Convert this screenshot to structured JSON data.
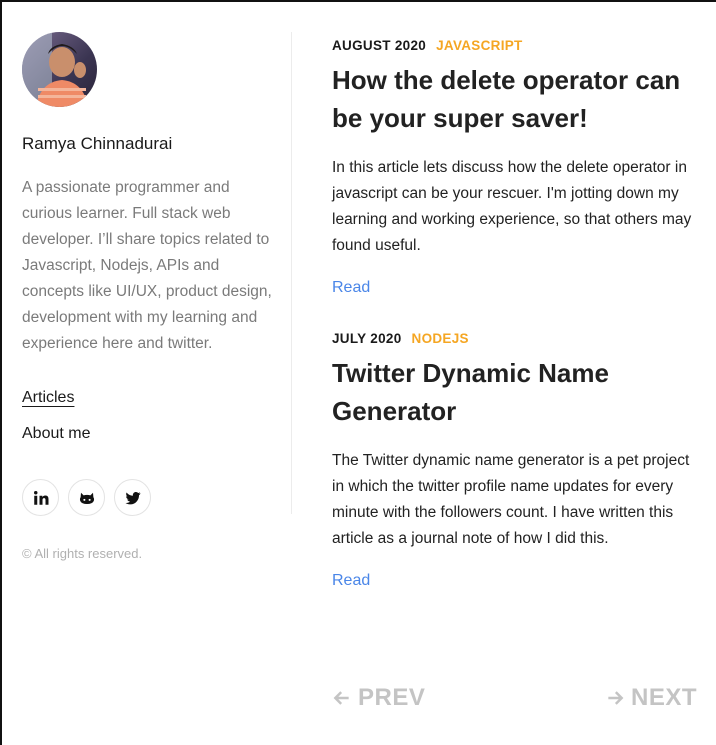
{
  "author": {
    "name": "Ramya Chinnadurai",
    "bio": "A passionate programmer and curious learner. Full stack web developer. I’ll share topics related to Javascript, Nodejs, APIs and concepts like UI/UX, product design, development with my learning and experience here and twitter."
  },
  "nav": {
    "articles": "Articles",
    "about": "About me"
  },
  "social_icons": [
    "linkedin-icon",
    "github-icon",
    "twitter-icon"
  ],
  "footer": {
    "copyright": "© All rights reserved."
  },
  "articles": [
    {
      "date": "AUGUST 2020",
      "tag": "JAVASCRIPT",
      "title": "How the delete operator can be your super saver!",
      "excerpt": "In this article lets discuss how the delete operator in javascript can be your rescuer. I'm jotting down my learning and working experience, so that others may found useful.",
      "read": "Read"
    },
    {
      "date": "JULY 2020",
      "tag": "NODEJS",
      "title": "Twitter Dynamic Name Generator",
      "excerpt": "The Twitter dynamic name generator is a pet project in which the twitter profile name updates for every minute with the followers count. I have written this article as a journal note of how I did this.",
      "read": "Read"
    }
  ],
  "pager": {
    "prev": "PREV",
    "next": "NEXT"
  },
  "colors": {
    "tag": "#f5a623",
    "link": "#4a86e8",
    "muted": "#7a7a7a",
    "pager": "#c4c4c4"
  }
}
